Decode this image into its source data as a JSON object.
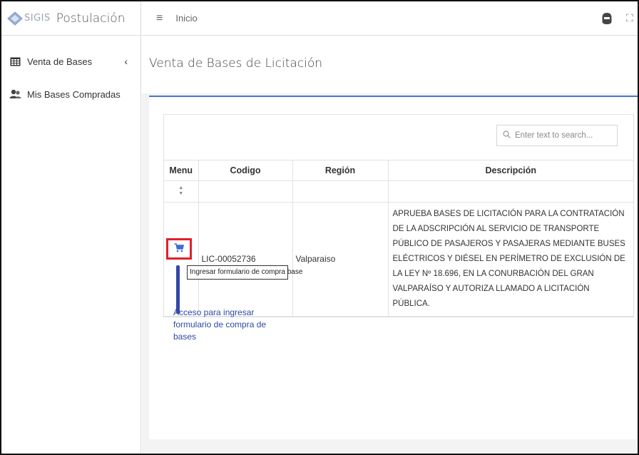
{
  "brand": {
    "logo_text": "SIGIS",
    "title": "Postulación"
  },
  "sidebar": {
    "items": [
      {
        "label": "Venta de Bases",
        "icon": "table-grid-icon"
      },
      {
        "label": "Mis Bases Compradas",
        "icon": "users-icon"
      }
    ]
  },
  "topbar": {
    "breadcrumb": "Inicio"
  },
  "page": {
    "title": "Venta de Bases de Licitación"
  },
  "table": {
    "search_placeholder": "Enter text to search...",
    "headers": [
      "Menu",
      "Codigo",
      "Región",
      "Descripción"
    ],
    "rows": [
      {
        "codigo": "LIC-00052736",
        "region": "Valparaiso",
        "descripcion": "APRUEBA BASES DE LICITACIÓN PARA LA CONTRATACIÓN DE LA ADSCRIPCIÓN AL SERVICIO DE TRANSPORTE PÚBLICO DE PASAJEROS Y PASAJERAS MEDIANTE BUSES ELÉCTRICOS Y DIÉSEL EN PERÍMETRO DE EXCLUSIÓN DE LA LEY Nº 18.696, EN LA CONURBACIÓN DEL GRAN VALPARAÍSO Y AUTORIZA LLAMADO A LICITACIÓN PÚBLICA."
      }
    ]
  },
  "tooltip": "Ingresar formulario de compra base",
  "annotation": "Acceso para ingresar formulario de compra de bases",
  "colors": {
    "accent": "#4a76c8",
    "highlight": "#e0202a",
    "annotation": "#2f4aa6"
  }
}
